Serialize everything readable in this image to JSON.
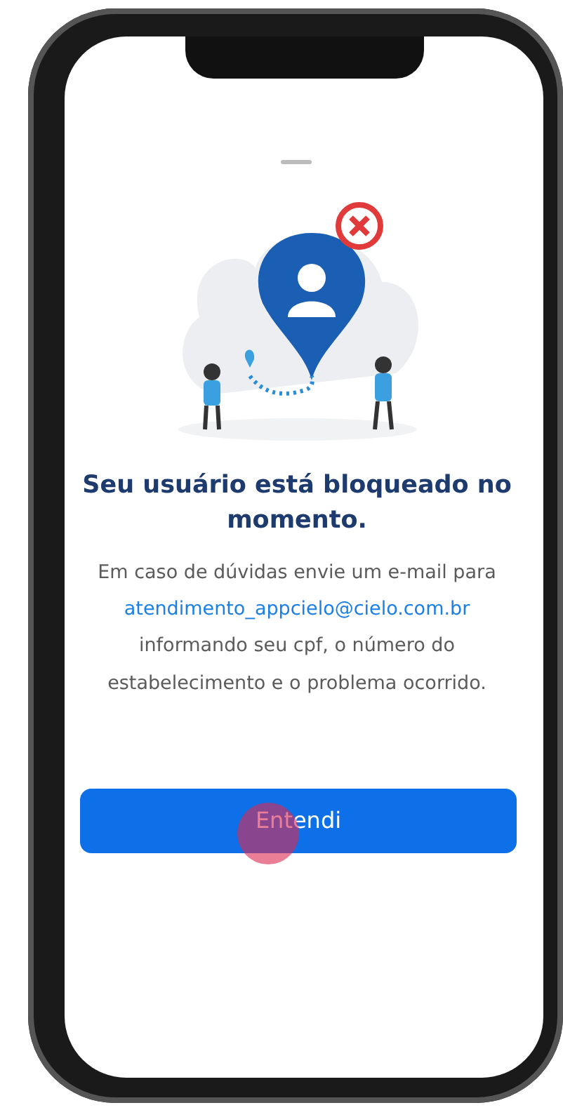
{
  "screen": {
    "title": "Seu usuário está bloqueado no momento.",
    "message": {
      "before": "Em caso de dúvidas envie um e-mail para",
      "email": "atendimento_appcielo@cielo.com.br",
      "after": "informando seu cpf, o número do estabelecimento e o problema ocorrido."
    },
    "button": "Entendi"
  }
}
